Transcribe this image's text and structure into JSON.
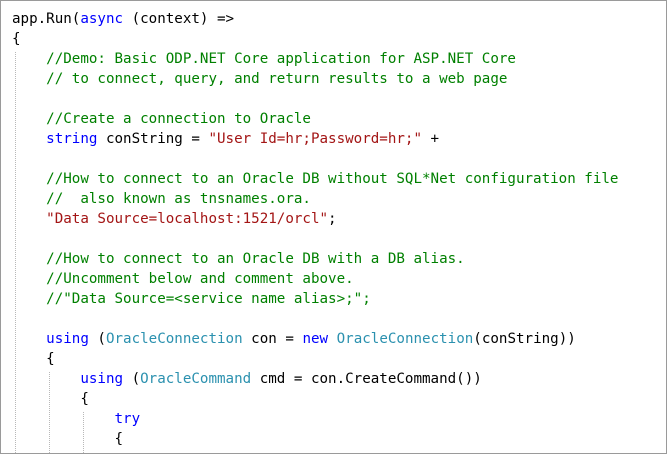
{
  "editor": {
    "lines": [
      [
        {
          "c": "pl",
          "t": "app.Run("
        },
        {
          "c": "kw",
          "t": "async"
        },
        {
          "c": "pl",
          "t": " (context) =>"
        }
      ],
      [
        {
          "c": "pl",
          "t": "{"
        }
      ],
      [
        {
          "c": "cm",
          "t": "    //Demo: Basic ODP.NET Core application for ASP.NET Core"
        }
      ],
      [
        {
          "c": "cm",
          "t": "    // to connect, query, and return results to a web page"
        }
      ],
      [],
      [
        {
          "c": "cm",
          "t": "    //Create a connection to Oracle"
        }
      ],
      [
        {
          "c": "kw",
          "t": "    string"
        },
        {
          "c": "pl",
          "t": " conString = "
        },
        {
          "c": "st",
          "t": "\"User Id=hr;Password=hr;\""
        },
        {
          "c": "pl",
          "t": " +"
        }
      ],
      [],
      [
        {
          "c": "cm",
          "t": "    //How to connect to an Oracle DB without SQL*Net configuration file"
        }
      ],
      [
        {
          "c": "cm",
          "t": "    //  also known as tnsnames.ora."
        }
      ],
      [
        {
          "c": "st",
          "t": "    \"Data Source=localhost:1521/orcl\""
        },
        {
          "c": "pl",
          "t": ";"
        }
      ],
      [],
      [
        {
          "c": "cm",
          "t": "    //How to connect to an Oracle DB with a DB alias."
        }
      ],
      [
        {
          "c": "cm",
          "t": "    //Uncomment below and comment above."
        }
      ],
      [
        {
          "c": "cm",
          "t": "    //\"Data Source=<service name alias>;\";"
        }
      ],
      [],
      [
        {
          "c": "kw",
          "t": "    using"
        },
        {
          "c": "pl",
          "t": " ("
        },
        {
          "c": "ty",
          "t": "OracleConnection"
        },
        {
          "c": "pl",
          "t": " con = "
        },
        {
          "c": "kw",
          "t": "new"
        },
        {
          "c": "pl",
          "t": " "
        },
        {
          "c": "ty",
          "t": "OracleConnection"
        },
        {
          "c": "pl",
          "t": "(conString))"
        }
      ],
      [
        {
          "c": "pl",
          "t": "    {"
        }
      ],
      [
        {
          "c": "kw",
          "t": "        using"
        },
        {
          "c": "pl",
          "t": " ("
        },
        {
          "c": "ty",
          "t": "OracleCommand"
        },
        {
          "c": "pl",
          "t": " cmd = con.CreateCommand())"
        }
      ],
      [
        {
          "c": "pl",
          "t": "        {"
        }
      ],
      [
        {
          "c": "kw",
          "t": "            try"
        }
      ],
      [
        {
          "c": "pl",
          "t": "            {"
        }
      ]
    ]
  }
}
